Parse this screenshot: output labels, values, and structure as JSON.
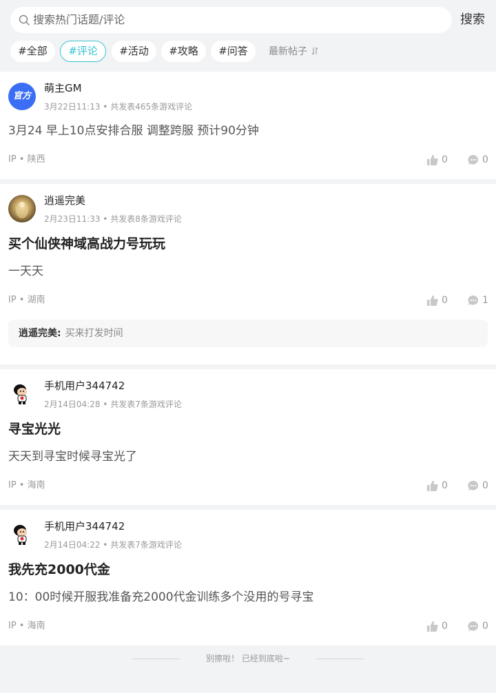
{
  "search": {
    "placeholder": "搜索热门话题/评论",
    "button": "搜索"
  },
  "tabs": [
    "#全部",
    "#评论",
    "#活动",
    "#攻略",
    "#问答"
  ],
  "active_tab": "#评论",
  "sort_label": "最新帖子",
  "posts": [
    {
      "user": "萌主GM",
      "avatar": "official-badge",
      "avatar_text": "官方",
      "meta": "3月22日11:13 • 共发表465条游戏评论",
      "title": "",
      "body": "3月24 早上10点安排合服 调整跨服 预计90分钟",
      "ip": "IP • 陕西",
      "likes": "0",
      "comments": "0"
    },
    {
      "user": "逍遥完美",
      "avatar": "golden-photo",
      "meta": "2月23日11:33 • 共发表8条游戏评论",
      "title": "买个仙侠神域高战力号玩玩",
      "body": "一天天",
      "ip": "IP • 湖南",
      "likes": "0",
      "comments": "1",
      "reply": {
        "name": "逍遥完美:",
        "text": "买来打发时间"
      }
    },
    {
      "user": "手机用户344742",
      "avatar": "cartoon-character",
      "meta": "2月14日04:28 • 共发表7条游戏评论",
      "title": "寻宝光光",
      "body": "天天到寻宝时候寻宝光了",
      "ip": "IP • 海南",
      "likes": "0",
      "comments": "0"
    },
    {
      "user": "手机用户344742",
      "avatar": "cartoon-character",
      "meta": "2月14日04:22 • 共发表7条游戏评论",
      "title": "我先充2000代金",
      "body": "10：00时候开服我准备充2000代金训练多个没用的号寻宝",
      "ip": "IP • 海南",
      "likes": "0",
      "comments": "0"
    }
  ],
  "footer": "别擦啦！ 已经到底啦~",
  "colors": {
    "accent": "#36c3d1",
    "official_badge": "#3b6ef5",
    "page_bg": "#f2f3f5"
  }
}
